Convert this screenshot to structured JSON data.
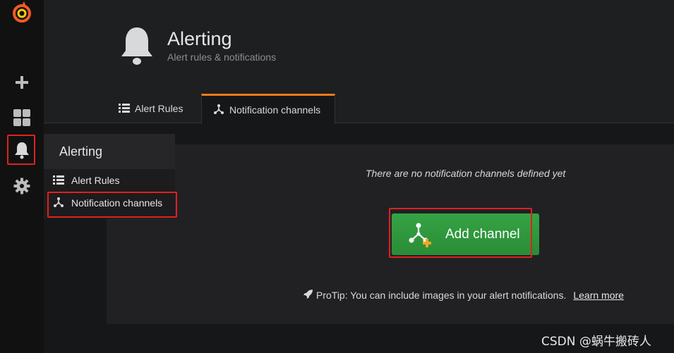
{
  "sidebar": {
    "icons": [
      "grafana-logo-icon",
      "plus-icon",
      "dashboard-icon",
      "bell-icon",
      "gear-icon"
    ]
  },
  "header": {
    "title": "Alerting",
    "subtitle": "Alert rules & notifications"
  },
  "tabs": [
    {
      "label": "Alert Rules",
      "icon": "list-icon",
      "active": false
    },
    {
      "label": "Notification channels",
      "icon": "channels-icon",
      "active": true
    }
  ],
  "flyout": {
    "title": "Alerting",
    "items": [
      {
        "label": "Alert Rules",
        "icon": "list-icon"
      },
      {
        "label": "Notification channels",
        "icon": "channels-icon"
      }
    ]
  },
  "main": {
    "empty_message": "There are no notification channels defined yet",
    "add_button_label": "Add channel",
    "protip_text": "ProTip: You can include images in your alert notifications.",
    "learn_more_label": "Learn more"
  },
  "watermark": "CSDN @蜗牛搬砖人",
  "colors": {
    "accent_orange": "#eb7b18",
    "button_green": "#2f9a3e",
    "highlight_red": "#e02020",
    "plus_orange": "#f5a623"
  }
}
